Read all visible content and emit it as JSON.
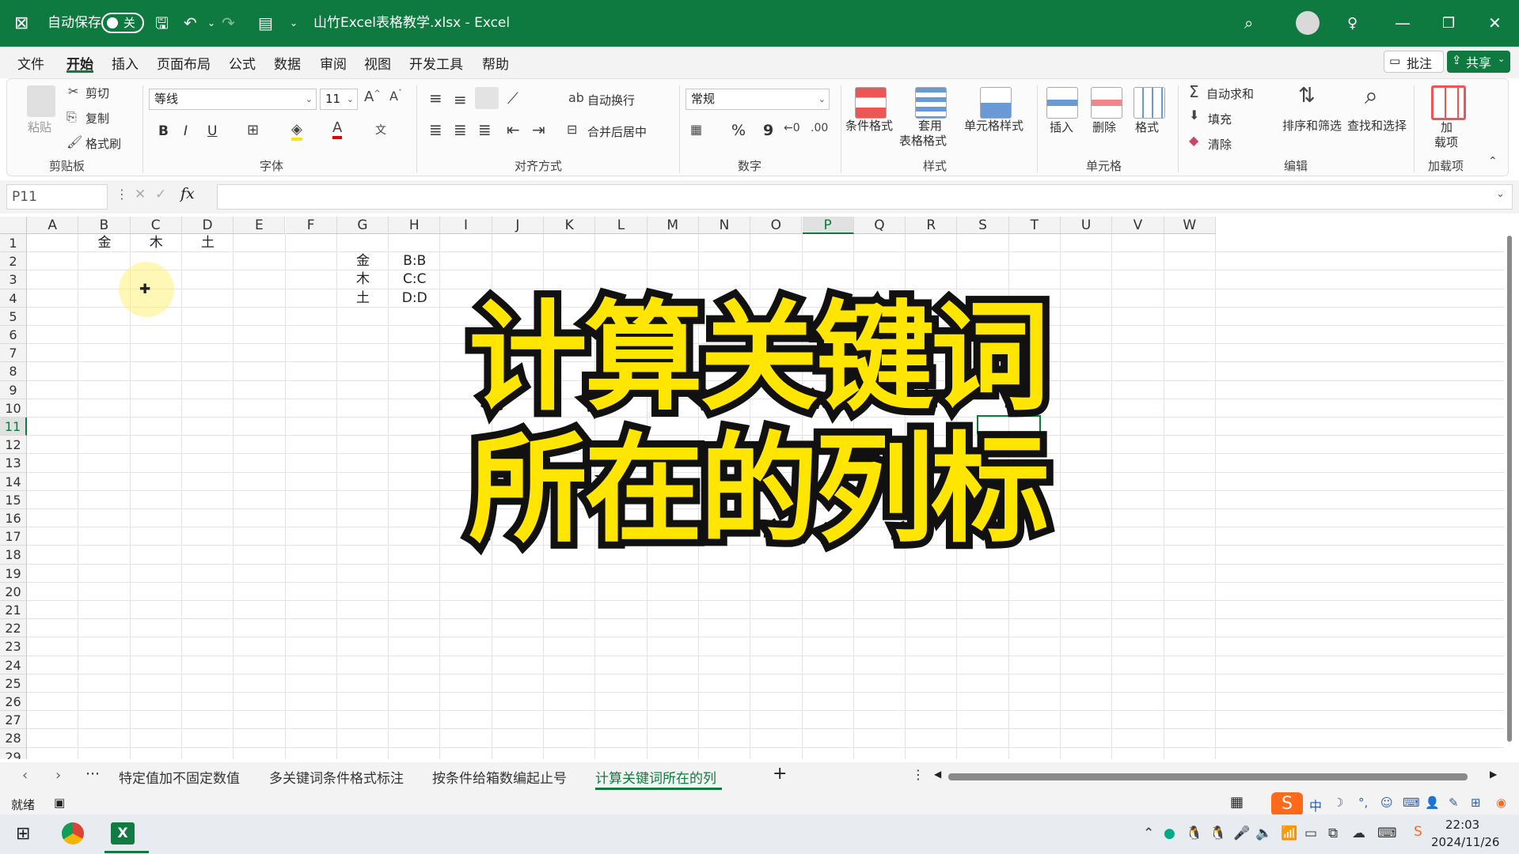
{
  "titlebar": {
    "autosave_label": "自动保存",
    "autosave_state": "关",
    "title": "山竹Excel表格教学.xlsx  -  Excel"
  },
  "menu": [
    "文件",
    "开始",
    "插入",
    "页面布局",
    "公式",
    "数据",
    "审阅",
    "视图",
    "开发工具",
    "帮助"
  ],
  "menu_right": {
    "comment": "批注",
    "share": "共享"
  },
  "ribbon": {
    "clipboard": {
      "paste": "粘贴",
      "cut": "剪切",
      "copy": "复制",
      "format_painter": "格式刷",
      "label": "剪贴板"
    },
    "font": {
      "name": "等线",
      "size": "11",
      "bold": "B",
      "italic": "I",
      "underline": "U",
      "label": "字体"
    },
    "alignment": {
      "wrap": "自动换行",
      "merge": "合并后居中",
      "label": "对齐方式"
    },
    "number": {
      "format": "常规",
      "percent": "%",
      "comma": "9",
      "label": "数字"
    },
    "styles": {
      "conditional": "条件格式",
      "table_line1": "套用",
      "table_line2": "表格格式",
      "cell_styles": "单元格样式",
      "label": "样式"
    },
    "cells": {
      "insert": "插入",
      "delete": "删除",
      "format": "格式",
      "label": "单元格"
    },
    "editing": {
      "autosum": "自动求和",
      "fill": "填充",
      "clear": "清除",
      "sort": "排序和筛选",
      "find": "查找和选择",
      "label": "编辑"
    },
    "addins": {
      "line1": "加",
      "line2": "载项",
      "label": "加载项"
    }
  },
  "namebox": "P11",
  "fx": "fx",
  "columns": [
    "A",
    "B",
    "C",
    "D",
    "E",
    "F",
    "G",
    "H",
    "I",
    "J",
    "K",
    "L",
    "M",
    "N",
    "O",
    "P",
    "Q",
    "R",
    "S",
    "T",
    "U",
    "V",
    "W"
  ],
  "rows": [
    "1",
    "2",
    "3",
    "4",
    "5",
    "6",
    "7",
    "8",
    "9",
    "10",
    "11",
    "12",
    "13",
    "14",
    "15",
    "16",
    "17",
    "18",
    "19",
    "20",
    "21",
    "22",
    "23",
    "24",
    "25",
    "26",
    "27",
    "28",
    "29"
  ],
  "cells": {
    "B1": "金",
    "C1": "木",
    "D1": "土",
    "G2": "金",
    "H2": "B:B",
    "G3": "木",
    "H3": "C:C",
    "G4": "土",
    "H4": "D:D"
  },
  "overlay": {
    "line1": "计算关键词",
    "line2": "所在的列标"
  },
  "sheet_tabs": [
    "特定值加不固定数值",
    "多关键词条件格式标注",
    "按条件给箱数编起止号",
    "计算关键词所在的列"
  ],
  "status": {
    "ready": "就绪"
  },
  "taskbar": {
    "time": "22:03",
    "date": "2024/11/26",
    "ime": "中"
  }
}
